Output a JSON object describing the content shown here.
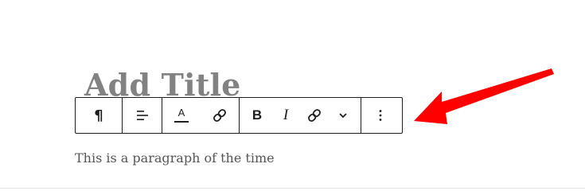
{
  "editor": {
    "title_placeholder": "Add Title",
    "paragraph_text": "This is a paragraph of the time"
  },
  "toolbar": {
    "paragraph_icon": "¶",
    "text_color_letter": "A",
    "buttons": [
      {
        "name": "paragraph-block-type",
        "icon": "pilcrow-icon"
      },
      {
        "name": "align",
        "icon": "align-left-icon"
      },
      {
        "name": "text-color",
        "icon": "text-color-icon"
      },
      {
        "name": "link",
        "icon": "link-icon"
      },
      {
        "name": "bold",
        "label": "B"
      },
      {
        "name": "italic",
        "label": "I"
      },
      {
        "name": "link",
        "icon": "link-icon"
      },
      {
        "name": "more-rich-text",
        "icon": "chevron-down-icon"
      },
      {
        "name": "options",
        "icon": "more-vertical-icon"
      }
    ]
  },
  "annotation": {
    "arrow_color": "#ff0000",
    "arrow_icon": "red-arrow-icon"
  },
  "colors": {
    "title": "#828282",
    "toolbar_border": "#1e1e1e",
    "paragraph": "#555555"
  }
}
